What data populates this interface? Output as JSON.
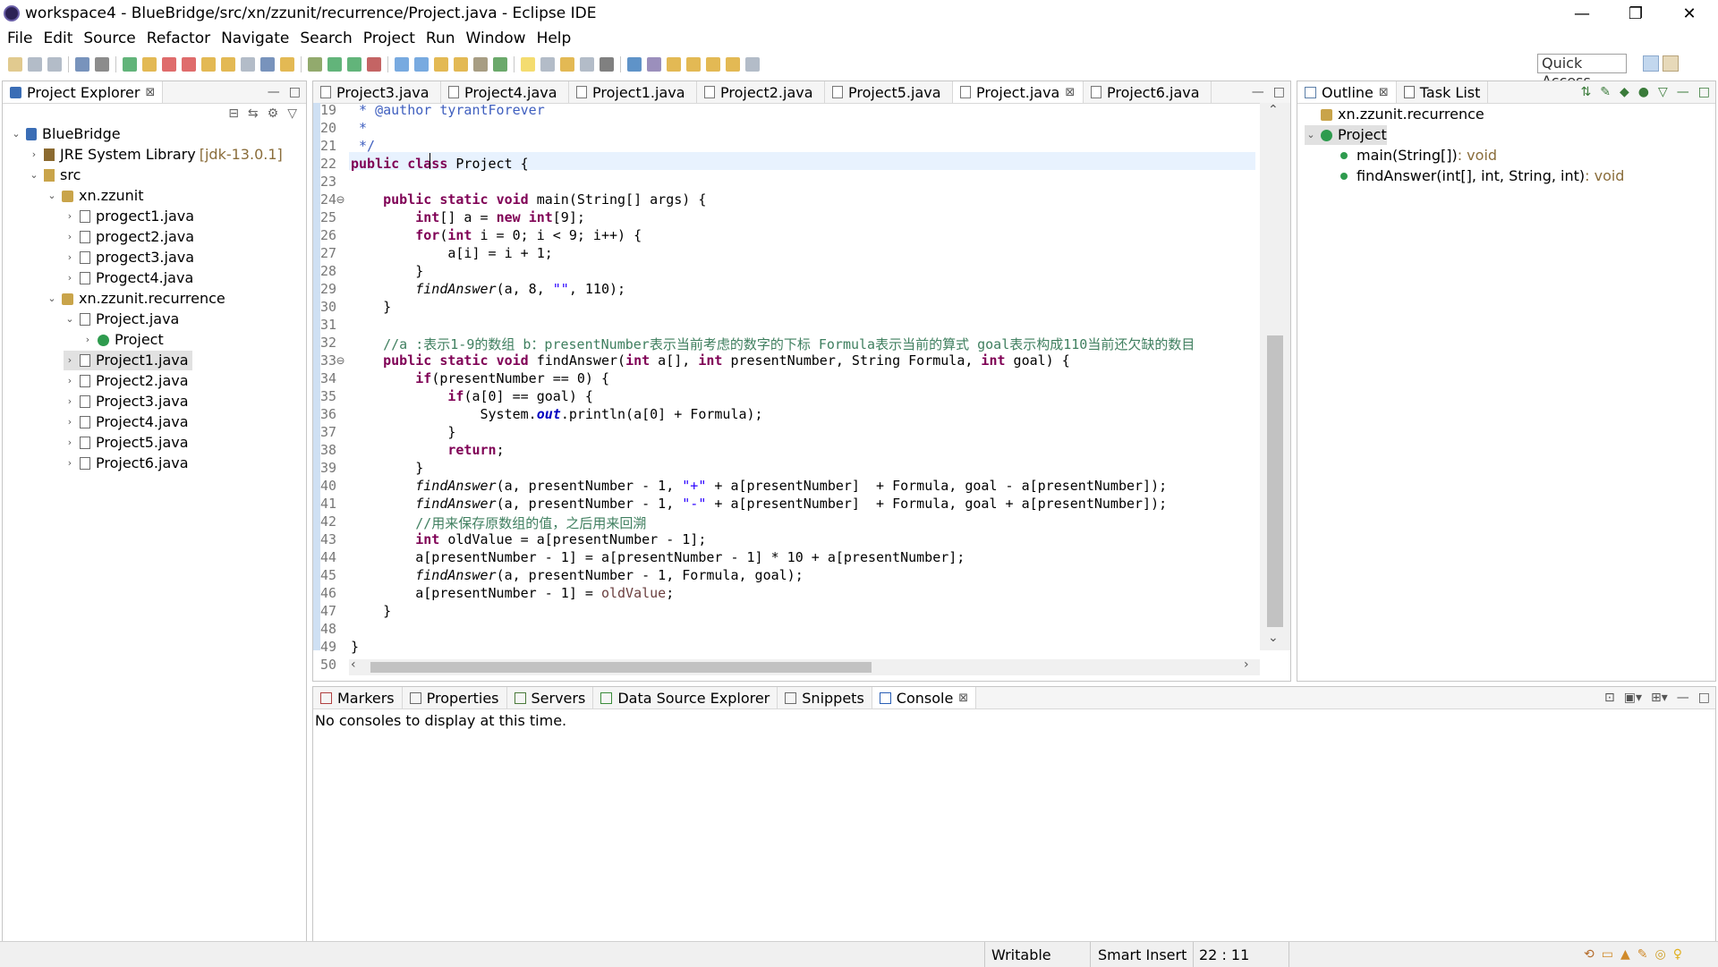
{
  "window": {
    "title": "workspace4 - BlueBridge/src/xn/zzunit/recurrence/Project.java - Eclipse IDE",
    "minimize": "—",
    "maximize": "❐",
    "close": "✕"
  },
  "menu": [
    "File",
    "Edit",
    "Source",
    "Refactor",
    "Navigate",
    "Search",
    "Project",
    "Run",
    "Window",
    "Help"
  ],
  "toolbar": {
    "quick_access": "Quick Access"
  },
  "project_explorer": {
    "title": "Project Explorer",
    "tree": [
      {
        "label": "BlueBridge",
        "suffix": "",
        "indent": 0,
        "twisty": "⌄",
        "icon": "project"
      },
      {
        "label": "JRE System Library",
        "suffix": "[jdk-13.0.1]",
        "indent": 1,
        "twisty": "›",
        "icon": "library"
      },
      {
        "label": "src",
        "suffix": "",
        "indent": 1,
        "twisty": "⌄",
        "icon": "src"
      },
      {
        "label": "xn.zzunit",
        "suffix": "",
        "indent": 2,
        "twisty": "⌄",
        "icon": "package"
      },
      {
        "label": "progect1.java",
        "suffix": "",
        "indent": 3,
        "twisty": "›",
        "icon": "file"
      },
      {
        "label": "progect2.java",
        "suffix": "",
        "indent": 3,
        "twisty": "›",
        "icon": "file"
      },
      {
        "label": "progect3.java",
        "suffix": "",
        "indent": 3,
        "twisty": "›",
        "icon": "file"
      },
      {
        "label": "Progect4.java",
        "suffix": "",
        "indent": 3,
        "twisty": "›",
        "icon": "file"
      },
      {
        "label": "xn.zzunit.recurrence",
        "suffix": "",
        "indent": 2,
        "twisty": "⌄",
        "icon": "package"
      },
      {
        "label": "Project.java",
        "suffix": "",
        "indent": 3,
        "twisty": "⌄",
        "icon": "file"
      },
      {
        "label": "Project",
        "suffix": "",
        "indent": 4,
        "twisty": "›",
        "icon": "class"
      },
      {
        "label": "Project1.java",
        "suffix": "",
        "indent": 3,
        "twisty": "›",
        "icon": "file",
        "selected": true
      },
      {
        "label": "Project2.java",
        "suffix": "",
        "indent": 3,
        "twisty": "›",
        "icon": "file"
      },
      {
        "label": "Project3.java",
        "suffix": "",
        "indent": 3,
        "twisty": "›",
        "icon": "file"
      },
      {
        "label": "Project4.java",
        "suffix": "",
        "indent": 3,
        "twisty": "›",
        "icon": "file"
      },
      {
        "label": "Project5.java",
        "suffix": "",
        "indent": 3,
        "twisty": "›",
        "icon": "file"
      },
      {
        "label": "Project6.java",
        "suffix": "",
        "indent": 3,
        "twisty": "›",
        "icon": "file"
      }
    ]
  },
  "editor": {
    "tabs": [
      {
        "label": "Project3.java",
        "active": false
      },
      {
        "label": "Project4.java",
        "active": false
      },
      {
        "label": "Project1.java",
        "active": false
      },
      {
        "label": "Project2.java",
        "active": false
      },
      {
        "label": "Project5.java",
        "active": false
      },
      {
        "label": "Project.java",
        "active": true
      },
      {
        "label": "Project6.java",
        "active": false
      }
    ],
    "lines": [
      {
        "n": "19",
        "html": "<span class=\"jd\"> * @author tyrantForever</span>"
      },
      {
        "n": "20",
        "html": "<span class=\"jd\"> *</span>"
      },
      {
        "n": "21",
        "html": "<span class=\"jd\"> */</span>"
      },
      {
        "n": "22",
        "html": "<span class=\"kw\">public</span> <span class=\"kw\">class</span> Project {"
      },
      {
        "n": "23",
        "html": ""
      },
      {
        "n": "24⊖",
        "html": "    <span class=\"kw\">public</span> <span class=\"kw\">static</span> <span class=\"kw\">void</span> main(String[] args) {"
      },
      {
        "n": "25",
        "html": "        <span class=\"kw\">int</span>[] a = <span class=\"kw\">new</span> <span class=\"kw\">int</span>[9];"
      },
      {
        "n": "26",
        "html": "        <span class=\"kw\">for</span>(<span class=\"kw\">int</span> i = 0; i &lt; 9; i++) {"
      },
      {
        "n": "27",
        "html": "            a[i] = i + 1;"
      },
      {
        "n": "28",
        "html": "        }"
      },
      {
        "n": "29",
        "html": "        <span class=\"it\">findAnswer</span>(a, 8, <span class=\"st\">\"\"</span>, 110);"
      },
      {
        "n": "30",
        "html": "    }"
      },
      {
        "n": "31",
        "html": ""
      },
      {
        "n": "32",
        "html": "    <span class=\"cm\">//a :表示1-9的数组 b：presentNumber表示当前考虑的数字的下标 Formula表示当前的算式 goal表示构成110当前还欠缺的数目</span>"
      },
      {
        "n": "33⊖",
        "html": "    <span class=\"kw\">public</span> <span class=\"kw\">static</span> <span class=\"kw\">void</span> findAnswer(<span class=\"kw\">int</span> a[], <span class=\"kw\">int</span> presentNumber, String Formula, <span class=\"kw\">int</span> goal) {"
      },
      {
        "n": "34",
        "html": "        <span class=\"kw\">if</span>(presentNumber == 0) {"
      },
      {
        "n": "35",
        "html": "            <span class=\"kw\">if</span>(a[0] == goal) {"
      },
      {
        "n": "36",
        "html": "                System.<span class=\"fld\">out</span>.println(a[0] + Formula);"
      },
      {
        "n": "37",
        "html": "            }"
      },
      {
        "n": "38",
        "html": "            <span class=\"kw\">return</span>;"
      },
      {
        "n": "39",
        "html": "        }"
      },
      {
        "n": "40",
        "html": "        <span class=\"it\">findAnswer</span>(a, presentNumber - 1, <span class=\"st\">\"+\"</span> + a[presentNumber]  + Formula, goal - a[presentNumber]);"
      },
      {
        "n": "41",
        "html": "        <span class=\"it\">findAnswer</span>(a, presentNumber - 1, <span class=\"st\">\"-\"</span> + a[presentNumber]  + Formula, goal + a[presentNumber]);"
      },
      {
        "n": "42",
        "html": "        <span class=\"cm\">//用来保存原数组的值，之后用来回溯</span>"
      },
      {
        "n": "43",
        "html": "        <span class=\"kw\">int</span> oldValue = a[presentNumber - 1];"
      },
      {
        "n": "44",
        "html": "        a[presentNumber - 1] = a[presentNumber - 1] * 10 + a[presentNumber];"
      },
      {
        "n": "45",
        "html": "        <span class=\"it\">findAnswer</span>(a, presentNumber - 1, Formula, goal);"
      },
      {
        "n": "46",
        "html": "        a[presentNumber - 1] = <span class=\"lv\">oldValue</span>;"
      },
      {
        "n": "47",
        "html": "    }"
      },
      {
        "n": "48",
        "html": ""
      },
      {
        "n": "49",
        "html": "}"
      },
      {
        "n": "50",
        "html": ""
      }
    ]
  },
  "outline": {
    "tabs": [
      "Outline",
      "Task List"
    ],
    "items": [
      {
        "label": "xn.zzunit.recurrence",
        "detail": "",
        "indent": 0,
        "twisty": "",
        "icon": "package"
      },
      {
        "label": "Project",
        "detail": "",
        "indent": 0,
        "twisty": "⌄",
        "icon": "class",
        "selected": true
      },
      {
        "label": "main(String[])",
        "detail": " : void",
        "indent": 1,
        "twisty": "",
        "icon": "method"
      },
      {
        "label": "findAnswer(int[], int, String, int)",
        "detail": " : void",
        "indent": 1,
        "twisty": "",
        "icon": "method"
      }
    ]
  },
  "bottom": {
    "tabs": [
      "Markers",
      "Properties",
      "Servers",
      "Data Source Explorer",
      "Snippets",
      "Console"
    ],
    "active": "Console",
    "message": "No consoles to display at this time."
  },
  "status": {
    "writable": "Writable",
    "insert_mode": "Smart Insert",
    "position": "22 : 11"
  },
  "colors": {
    "keyword": "#7f0055",
    "comment": "#3f7f5f",
    "javadoc": "#3f5fbf",
    "string": "#2a00ff",
    "line_highlight": "#e8f2fe"
  }
}
